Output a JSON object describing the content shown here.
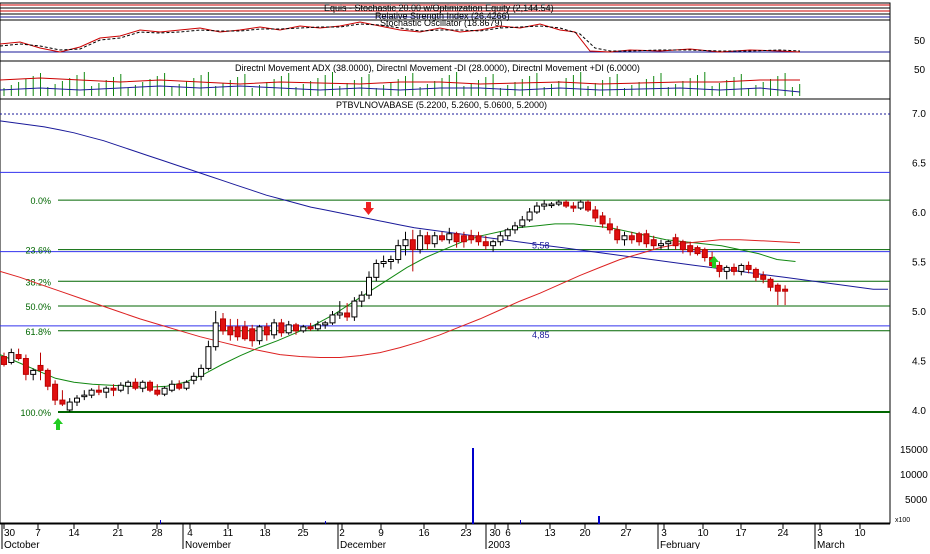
{
  "panels": {
    "equity": {
      "label": "Equis - Stochastic 20.00 w/Optimization Equity (2,144.54)"
    },
    "stochastic": {
      "label_rsi": "Relative Strength Index (26.4266)",
      "label_stoch": "Stochastic Oscillator (18.8679)",
      "level": "50"
    },
    "dmi": {
      "label": "Directnl Movement ADX (38.0000), Directnl Movement -DI (28.0000), Directnl Movement +DI (6.0000)",
      "level": "50"
    },
    "price": {
      "label": "PTBVLNOVABASE (5.2200, 5.2600, 5.0600, 5.2000)"
    }
  },
  "colors": {
    "up": "#ffffff",
    "down": "#e01010",
    "neutral": "#000000",
    "ma_long": "#1a1a9a",
    "ma_mid": "#118811",
    "ma_short": "#dd2222",
    "fib": "#006600",
    "volume": "#0000cc",
    "panel_border": "#000000"
  },
  "chart_data": {
    "type": "candlestick",
    "title": "PTBVLNOVABASE (5.2200, 5.2600, 5.0600, 5.2000)",
    "ylim": [
      3.7,
      7.05
    ],
    "y_ticks": [
      "7.0",
      "6.5",
      "6.0",
      "5.5",
      "5.0",
      "4.5",
      "4.0"
    ],
    "fib_levels": [
      {
        "label": "0.0%",
        "value": 6.12
      },
      {
        "label": "23.6%",
        "value": 5.62
      },
      {
        "label": "38.2%",
        "value": 5.3
      },
      {
        "label": "50.0%",
        "value": 5.05
      },
      {
        "label": "61.8%",
        "value": 4.8
      },
      {
        "label": "100.0%",
        "value": 3.98
      }
    ],
    "hlines": [
      {
        "value": 6.4,
        "annotation": ""
      },
      {
        "value": 5.6,
        "annotation": "5,58"
      },
      {
        "value": 4.85,
        "annotation": "4,85"
      }
    ],
    "x_ticks": [
      "30",
      "7",
      "14",
      "21",
      "28",
      "4",
      "11",
      "18",
      "25",
      "2",
      "9",
      "16",
      "23",
      "30",
      "6",
      "13",
      "20",
      "27",
      "3",
      "10",
      "17",
      "24",
      "3",
      "10"
    ],
    "month_labels": [
      "October",
      "November",
      "December",
      "2003",
      "February",
      "March"
    ],
    "candles": [
      {
        "o": 4.54,
        "h": 4.58,
        "l": 4.44,
        "c": 4.46
      },
      {
        "o": 4.48,
        "h": 4.62,
        "l": 4.46,
        "c": 4.58
      },
      {
        "o": 4.56,
        "h": 4.62,
        "l": 4.5,
        "c": 4.52
      },
      {
        "o": 4.52,
        "h": 4.56,
        "l": 4.3,
        "c": 4.36
      },
      {
        "o": 4.36,
        "h": 4.42,
        "l": 4.3,
        "c": 4.4
      },
      {
        "o": 4.45,
        "h": 4.58,
        "l": 4.3,
        "c": 4.4
      },
      {
        "o": 4.4,
        "h": 4.42,
        "l": 4.2,
        "c": 4.24
      },
      {
        "o": 4.26,
        "h": 4.3,
        "l": 4.05,
        "c": 4.1
      },
      {
        "o": 4.1,
        "h": 4.2,
        "l": 4.04,
        "c": 4.06
      },
      {
        "o": 4.0,
        "h": 4.12,
        "l": 3.98,
        "c": 4.08
      },
      {
        "o": 4.08,
        "h": 4.15,
        "l": 4.04,
        "c": 4.12
      },
      {
        "o": 4.14,
        "h": 4.2,
        "l": 4.1,
        "c": 4.15
      },
      {
        "o": 4.15,
        "h": 4.22,
        "l": 4.12,
        "c": 4.2
      },
      {
        "o": 4.2,
        "h": 4.25,
        "l": 4.15,
        "c": 4.18
      },
      {
        "o": 4.18,
        "h": 4.24,
        "l": 4.12,
        "c": 4.22
      },
      {
        "o": 4.22,
        "h": 4.26,
        "l": 4.14,
        "c": 4.2
      },
      {
        "o": 4.2,
        "h": 4.28,
        "l": 4.18,
        "c": 4.25
      },
      {
        "o": 4.24,
        "h": 4.3,
        "l": 4.16,
        "c": 4.28
      },
      {
        "o": 4.28,
        "h": 4.32,
        "l": 4.2,
        "c": 4.22
      },
      {
        "o": 4.22,
        "h": 4.3,
        "l": 4.18,
        "c": 4.28
      },
      {
        "o": 4.28,
        "h": 4.3,
        "l": 4.18,
        "c": 4.2
      },
      {
        "o": 4.2,
        "h": 4.26,
        "l": 4.14,
        "c": 4.16
      },
      {
        "o": 4.16,
        "h": 4.24,
        "l": 4.14,
        "c": 4.22
      },
      {
        "o": 4.2,
        "h": 4.3,
        "l": 4.18,
        "c": 4.26
      },
      {
        "o": 4.26,
        "h": 4.3,
        "l": 4.2,
        "c": 4.22
      },
      {
        "o": 4.22,
        "h": 4.3,
        "l": 4.2,
        "c": 4.28
      },
      {
        "o": 4.3,
        "h": 4.38,
        "l": 4.26,
        "c": 4.34
      },
      {
        "o": 4.34,
        "h": 4.46,
        "l": 4.3,
        "c": 4.42
      },
      {
        "o": 4.42,
        "h": 4.7,
        "l": 4.4,
        "c": 4.64
      },
      {
        "o": 4.64,
        "h": 5.0,
        "l": 4.6,
        "c": 4.88
      },
      {
        "o": 4.92,
        "h": 4.98,
        "l": 4.76,
        "c": 4.8
      },
      {
        "o": 4.84,
        "h": 4.92,
        "l": 4.7,
        "c": 4.76
      },
      {
        "o": 4.84,
        "h": 4.92,
        "l": 4.7,
        "c": 4.74
      },
      {
        "o": 4.84,
        "h": 4.9,
        "l": 4.7,
        "c": 4.72
      },
      {
        "o": 4.82,
        "h": 4.86,
        "l": 4.64,
        "c": 4.7
      },
      {
        "o": 4.7,
        "h": 4.86,
        "l": 4.66,
        "c": 4.84
      },
      {
        "o": 4.84,
        "h": 4.88,
        "l": 4.7,
        "c": 4.76
      },
      {
        "o": 4.76,
        "h": 4.92,
        "l": 4.72,
        "c": 4.88
      },
      {
        "o": 4.88,
        "h": 4.92,
        "l": 4.74,
        "c": 4.78
      },
      {
        "o": 4.78,
        "h": 4.9,
        "l": 4.76,
        "c": 4.86
      },
      {
        "o": 4.86,
        "h": 4.88,
        "l": 4.76,
        "c": 4.8
      },
      {
        "o": 4.8,
        "h": 4.86,
        "l": 4.78,
        "c": 4.84
      },
      {
        "o": 4.84,
        "h": 4.88,
        "l": 4.8,
        "c": 4.82
      },
      {
        "o": 4.82,
        "h": 4.9,
        "l": 4.8,
        "c": 4.86
      },
      {
        "o": 4.86,
        "h": 4.9,
        "l": 4.82,
        "c": 4.88
      },
      {
        "o": 4.88,
        "h": 5.0,
        "l": 4.86,
        "c": 4.96
      },
      {
        "o": 4.96,
        "h": 5.1,
        "l": 4.92,
        "c": 4.98
      },
      {
        "o": 4.98,
        "h": 5.08,
        "l": 4.9,
        "c": 4.94
      },
      {
        "o": 4.94,
        "h": 5.14,
        "l": 4.9,
        "c": 5.1
      },
      {
        "o": 5.1,
        "h": 5.2,
        "l": 5.04,
        "c": 5.16
      },
      {
        "o": 5.16,
        "h": 5.4,
        "l": 5.12,
        "c": 5.34
      },
      {
        "o": 5.34,
        "h": 5.52,
        "l": 5.3,
        "c": 5.48
      },
      {
        "o": 5.48,
        "h": 5.56,
        "l": 5.44,
        "c": 5.5
      },
      {
        "o": 5.5,
        "h": 5.56,
        "l": 5.42,
        "c": 5.52
      },
      {
        "o": 5.52,
        "h": 5.72,
        "l": 5.48,
        "c": 5.66
      },
      {
        "o": 5.66,
        "h": 5.8,
        "l": 5.56,
        "c": 5.72
      },
      {
        "o": 5.72,
        "h": 5.82,
        "l": 5.4,
        "c": 5.62
      },
      {
        "o": 5.62,
        "h": 5.82,
        "l": 5.58,
        "c": 5.76
      },
      {
        "o": 5.76,
        "h": 5.8,
        "l": 5.62,
        "c": 5.68
      },
      {
        "o": 5.68,
        "h": 5.8,
        "l": 5.64,
        "c": 5.76
      },
      {
        "o": 5.76,
        "h": 5.8,
        "l": 5.7,
        "c": 5.72
      },
      {
        "o": 5.72,
        "h": 5.84,
        "l": 5.68,
        "c": 5.78
      },
      {
        "o": 5.78,
        "h": 5.8,
        "l": 5.64,
        "c": 5.7
      },
      {
        "o": 5.76,
        "h": 5.8,
        "l": 5.64,
        "c": 5.7
      },
      {
        "o": 5.76,
        "h": 5.82,
        "l": 5.68,
        "c": 5.72
      },
      {
        "o": 5.76,
        "h": 5.8,
        "l": 5.66,
        "c": 5.7
      },
      {
        "o": 5.7,
        "h": 5.76,
        "l": 5.62,
        "c": 5.66
      },
      {
        "o": 5.66,
        "h": 5.72,
        "l": 5.6,
        "c": 5.7
      },
      {
        "o": 5.7,
        "h": 5.8,
        "l": 5.66,
        "c": 5.76
      },
      {
        "o": 5.76,
        "h": 5.84,
        "l": 5.72,
        "c": 5.82
      },
      {
        "o": 5.82,
        "h": 5.9,
        "l": 5.78,
        "c": 5.86
      },
      {
        "o": 5.86,
        "h": 5.96,
        "l": 5.84,
        "c": 5.92
      },
      {
        "o": 5.92,
        "h": 6.04,
        "l": 5.9,
        "c": 6.0
      },
      {
        "o": 6.0,
        "h": 6.1,
        "l": 5.98,
        "c": 6.06
      },
      {
        "o": 6.06,
        "h": 6.12,
        "l": 6.02,
        "c": 6.08
      },
      {
        "o": 6.08,
        "h": 6.1,
        "l": 6.04,
        "c": 6.08
      },
      {
        "o": 6.08,
        "h": 6.12,
        "l": 6.06,
        "c": 6.1
      },
      {
        "o": 6.1,
        "h": 6.12,
        "l": 6.04,
        "c": 6.06
      },
      {
        "o": 6.06,
        "h": 6.1,
        "l": 6.0,
        "c": 6.04
      },
      {
        "o": 6.04,
        "h": 6.12,
        "l": 6.02,
        "c": 6.1
      },
      {
        "o": 6.1,
        "h": 6.12,
        "l": 6.0,
        "c": 6.02
      },
      {
        "o": 6.02,
        "h": 6.06,
        "l": 5.9,
        "c": 5.94
      },
      {
        "o": 5.96,
        "h": 6.0,
        "l": 5.84,
        "c": 5.88
      },
      {
        "o": 5.88,
        "h": 5.94,
        "l": 5.78,
        "c": 5.82
      },
      {
        "o": 5.82,
        "h": 5.86,
        "l": 5.68,
        "c": 5.72
      },
      {
        "o": 5.72,
        "h": 5.8,
        "l": 5.66,
        "c": 5.76
      },
      {
        "o": 5.76,
        "h": 5.8,
        "l": 5.68,
        "c": 5.72
      },
      {
        "o": 5.78,
        "h": 5.8,
        "l": 5.66,
        "c": 5.7
      },
      {
        "o": 5.78,
        "h": 5.82,
        "l": 5.64,
        "c": 5.68
      },
      {
        "o": 5.72,
        "h": 5.76,
        "l": 5.62,
        "c": 5.66
      },
      {
        "o": 5.66,
        "h": 5.72,
        "l": 5.62,
        "c": 5.68
      },
      {
        "o": 5.68,
        "h": 5.72,
        "l": 5.62,
        "c": 5.7
      },
      {
        "o": 5.74,
        "h": 5.78,
        "l": 5.62,
        "c": 5.66
      },
      {
        "o": 5.7,
        "h": 5.72,
        "l": 5.58,
        "c": 5.62
      },
      {
        "o": 5.66,
        "h": 5.7,
        "l": 5.56,
        "c": 5.6
      },
      {
        "o": 5.64,
        "h": 5.66,
        "l": 5.56,
        "c": 5.58
      },
      {
        "o": 5.62,
        "h": 5.64,
        "l": 5.5,
        "c": 5.54
      },
      {
        "o": 5.54,
        "h": 5.6,
        "l": 5.44,
        "c": 5.46
      },
      {
        "o": 5.46,
        "h": 5.5,
        "l": 5.34,
        "c": 5.4
      },
      {
        "o": 5.4,
        "h": 5.46,
        "l": 5.32,
        "c": 5.44
      },
      {
        "o": 5.44,
        "h": 5.48,
        "l": 5.36,
        "c": 5.4
      },
      {
        "o": 5.4,
        "h": 5.48,
        "l": 5.36,
        "c": 5.46
      },
      {
        "o": 5.46,
        "h": 5.5,
        "l": 5.38,
        "c": 5.42
      },
      {
        "o": 5.42,
        "h": 5.44,
        "l": 5.3,
        "c": 5.34
      },
      {
        "o": 5.36,
        "h": 5.4,
        "l": 5.28,
        "c": 5.32
      },
      {
        "o": 5.32,
        "h": 5.34,
        "l": 5.2,
        "c": 5.24
      },
      {
        "o": 5.26,
        "h": 5.28,
        "l": 5.06,
        "c": 5.2
      },
      {
        "o": 5.22,
        "h": 5.26,
        "l": 5.06,
        "c": 5.2
      }
    ],
    "ma_long": [
      6.92,
      6.9,
      6.88,
      6.86,
      6.83,
      6.8,
      6.76,
      6.72,
      6.67,
      6.62,
      6.57,
      6.52,
      6.47,
      6.42,
      6.37,
      6.32,
      6.27,
      6.22,
      6.17,
      6.13,
      6.09,
      6.05,
      6.02,
      5.99,
      5.96,
      5.93,
      5.9,
      5.87,
      5.84,
      5.82,
      5.8,
      5.78,
      5.76,
      5.74,
      5.72,
      5.7,
      5.68,
      5.66,
      5.64,
      5.62,
      5.6,
      5.58,
      5.56,
      5.54,
      5.52,
      5.5,
      5.48,
      5.46,
      5.44,
      5.42,
      5.4,
      5.38,
      5.36,
      5.34,
      5.32,
      5.3,
      5.28,
      5.26,
      5.24,
      5.22,
      5.22
    ],
    "ma_mid": [
      4.56,
      4.48,
      4.4,
      4.32,
      4.28,
      4.26,
      4.25,
      4.24,
      4.23,
      4.24,
      4.28,
      4.36,
      4.46,
      4.55,
      4.63,
      4.7,
      4.78,
      4.86,
      4.96,
      5.08,
      5.2,
      5.32,
      5.44,
      5.54,
      5.62,
      5.7,
      5.76,
      5.8,
      5.84,
      5.86,
      5.88,
      5.88,
      5.86,
      5.84,
      5.8,
      5.76,
      5.72,
      5.7,
      5.68,
      5.66,
      5.62,
      5.58,
      5.52,
      5.5
    ],
    "ma_short": [
      5.4,
      5.34,
      5.27,
      5.2,
      5.13,
      5.06,
      4.99,
      4.92,
      4.86,
      4.8,
      4.74,
      4.69,
      4.64,
      4.6,
      4.56,
      4.54,
      4.53,
      4.53,
      4.55,
      4.58,
      4.63,
      4.69,
      4.76,
      4.84,
      4.92,
      5.01,
      5.1,
      5.18,
      5.27,
      5.36,
      5.44,
      5.52,
      5.58,
      5.64,
      5.68,
      5.7,
      5.72,
      5.72,
      5.71,
      5.7,
      5.69
    ]
  }
}
